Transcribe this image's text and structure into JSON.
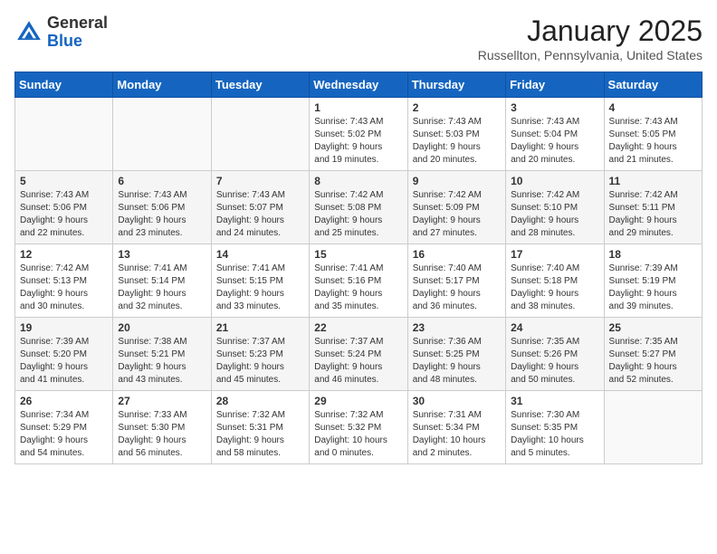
{
  "header": {
    "logo_general": "General",
    "logo_blue": "Blue",
    "month_title": "January 2025",
    "location": "Russellton, Pennsylvania, United States"
  },
  "weekdays": [
    "Sunday",
    "Monday",
    "Tuesday",
    "Wednesday",
    "Thursday",
    "Friday",
    "Saturday"
  ],
  "weeks": [
    [
      {
        "day": "",
        "info": ""
      },
      {
        "day": "",
        "info": ""
      },
      {
        "day": "",
        "info": ""
      },
      {
        "day": "1",
        "info": "Sunrise: 7:43 AM\nSunset: 5:02 PM\nDaylight: 9 hours\nand 19 minutes."
      },
      {
        "day": "2",
        "info": "Sunrise: 7:43 AM\nSunset: 5:03 PM\nDaylight: 9 hours\nand 20 minutes."
      },
      {
        "day": "3",
        "info": "Sunrise: 7:43 AM\nSunset: 5:04 PM\nDaylight: 9 hours\nand 20 minutes."
      },
      {
        "day": "4",
        "info": "Sunrise: 7:43 AM\nSunset: 5:05 PM\nDaylight: 9 hours\nand 21 minutes."
      }
    ],
    [
      {
        "day": "5",
        "info": "Sunrise: 7:43 AM\nSunset: 5:06 PM\nDaylight: 9 hours\nand 22 minutes."
      },
      {
        "day": "6",
        "info": "Sunrise: 7:43 AM\nSunset: 5:06 PM\nDaylight: 9 hours\nand 23 minutes."
      },
      {
        "day": "7",
        "info": "Sunrise: 7:43 AM\nSunset: 5:07 PM\nDaylight: 9 hours\nand 24 minutes."
      },
      {
        "day": "8",
        "info": "Sunrise: 7:42 AM\nSunset: 5:08 PM\nDaylight: 9 hours\nand 25 minutes."
      },
      {
        "day": "9",
        "info": "Sunrise: 7:42 AM\nSunset: 5:09 PM\nDaylight: 9 hours\nand 27 minutes."
      },
      {
        "day": "10",
        "info": "Sunrise: 7:42 AM\nSunset: 5:10 PM\nDaylight: 9 hours\nand 28 minutes."
      },
      {
        "day": "11",
        "info": "Sunrise: 7:42 AM\nSunset: 5:11 PM\nDaylight: 9 hours\nand 29 minutes."
      }
    ],
    [
      {
        "day": "12",
        "info": "Sunrise: 7:42 AM\nSunset: 5:13 PM\nDaylight: 9 hours\nand 30 minutes."
      },
      {
        "day": "13",
        "info": "Sunrise: 7:41 AM\nSunset: 5:14 PM\nDaylight: 9 hours\nand 32 minutes."
      },
      {
        "day": "14",
        "info": "Sunrise: 7:41 AM\nSunset: 5:15 PM\nDaylight: 9 hours\nand 33 minutes."
      },
      {
        "day": "15",
        "info": "Sunrise: 7:41 AM\nSunset: 5:16 PM\nDaylight: 9 hours\nand 35 minutes."
      },
      {
        "day": "16",
        "info": "Sunrise: 7:40 AM\nSunset: 5:17 PM\nDaylight: 9 hours\nand 36 minutes."
      },
      {
        "day": "17",
        "info": "Sunrise: 7:40 AM\nSunset: 5:18 PM\nDaylight: 9 hours\nand 38 minutes."
      },
      {
        "day": "18",
        "info": "Sunrise: 7:39 AM\nSunset: 5:19 PM\nDaylight: 9 hours\nand 39 minutes."
      }
    ],
    [
      {
        "day": "19",
        "info": "Sunrise: 7:39 AM\nSunset: 5:20 PM\nDaylight: 9 hours\nand 41 minutes."
      },
      {
        "day": "20",
        "info": "Sunrise: 7:38 AM\nSunset: 5:21 PM\nDaylight: 9 hours\nand 43 minutes."
      },
      {
        "day": "21",
        "info": "Sunrise: 7:37 AM\nSunset: 5:23 PM\nDaylight: 9 hours\nand 45 minutes."
      },
      {
        "day": "22",
        "info": "Sunrise: 7:37 AM\nSunset: 5:24 PM\nDaylight: 9 hours\nand 46 minutes."
      },
      {
        "day": "23",
        "info": "Sunrise: 7:36 AM\nSunset: 5:25 PM\nDaylight: 9 hours\nand 48 minutes."
      },
      {
        "day": "24",
        "info": "Sunrise: 7:35 AM\nSunset: 5:26 PM\nDaylight: 9 hours\nand 50 minutes."
      },
      {
        "day": "25",
        "info": "Sunrise: 7:35 AM\nSunset: 5:27 PM\nDaylight: 9 hours\nand 52 minutes."
      }
    ],
    [
      {
        "day": "26",
        "info": "Sunrise: 7:34 AM\nSunset: 5:29 PM\nDaylight: 9 hours\nand 54 minutes."
      },
      {
        "day": "27",
        "info": "Sunrise: 7:33 AM\nSunset: 5:30 PM\nDaylight: 9 hours\nand 56 minutes."
      },
      {
        "day": "28",
        "info": "Sunrise: 7:32 AM\nSunset: 5:31 PM\nDaylight: 9 hours\nand 58 minutes."
      },
      {
        "day": "29",
        "info": "Sunrise: 7:32 AM\nSunset: 5:32 PM\nDaylight: 10 hours\nand 0 minutes."
      },
      {
        "day": "30",
        "info": "Sunrise: 7:31 AM\nSunset: 5:34 PM\nDaylight: 10 hours\nand 2 minutes."
      },
      {
        "day": "31",
        "info": "Sunrise: 7:30 AM\nSunset: 5:35 PM\nDaylight: 10 hours\nand 5 minutes."
      },
      {
        "day": "",
        "info": ""
      }
    ]
  ]
}
